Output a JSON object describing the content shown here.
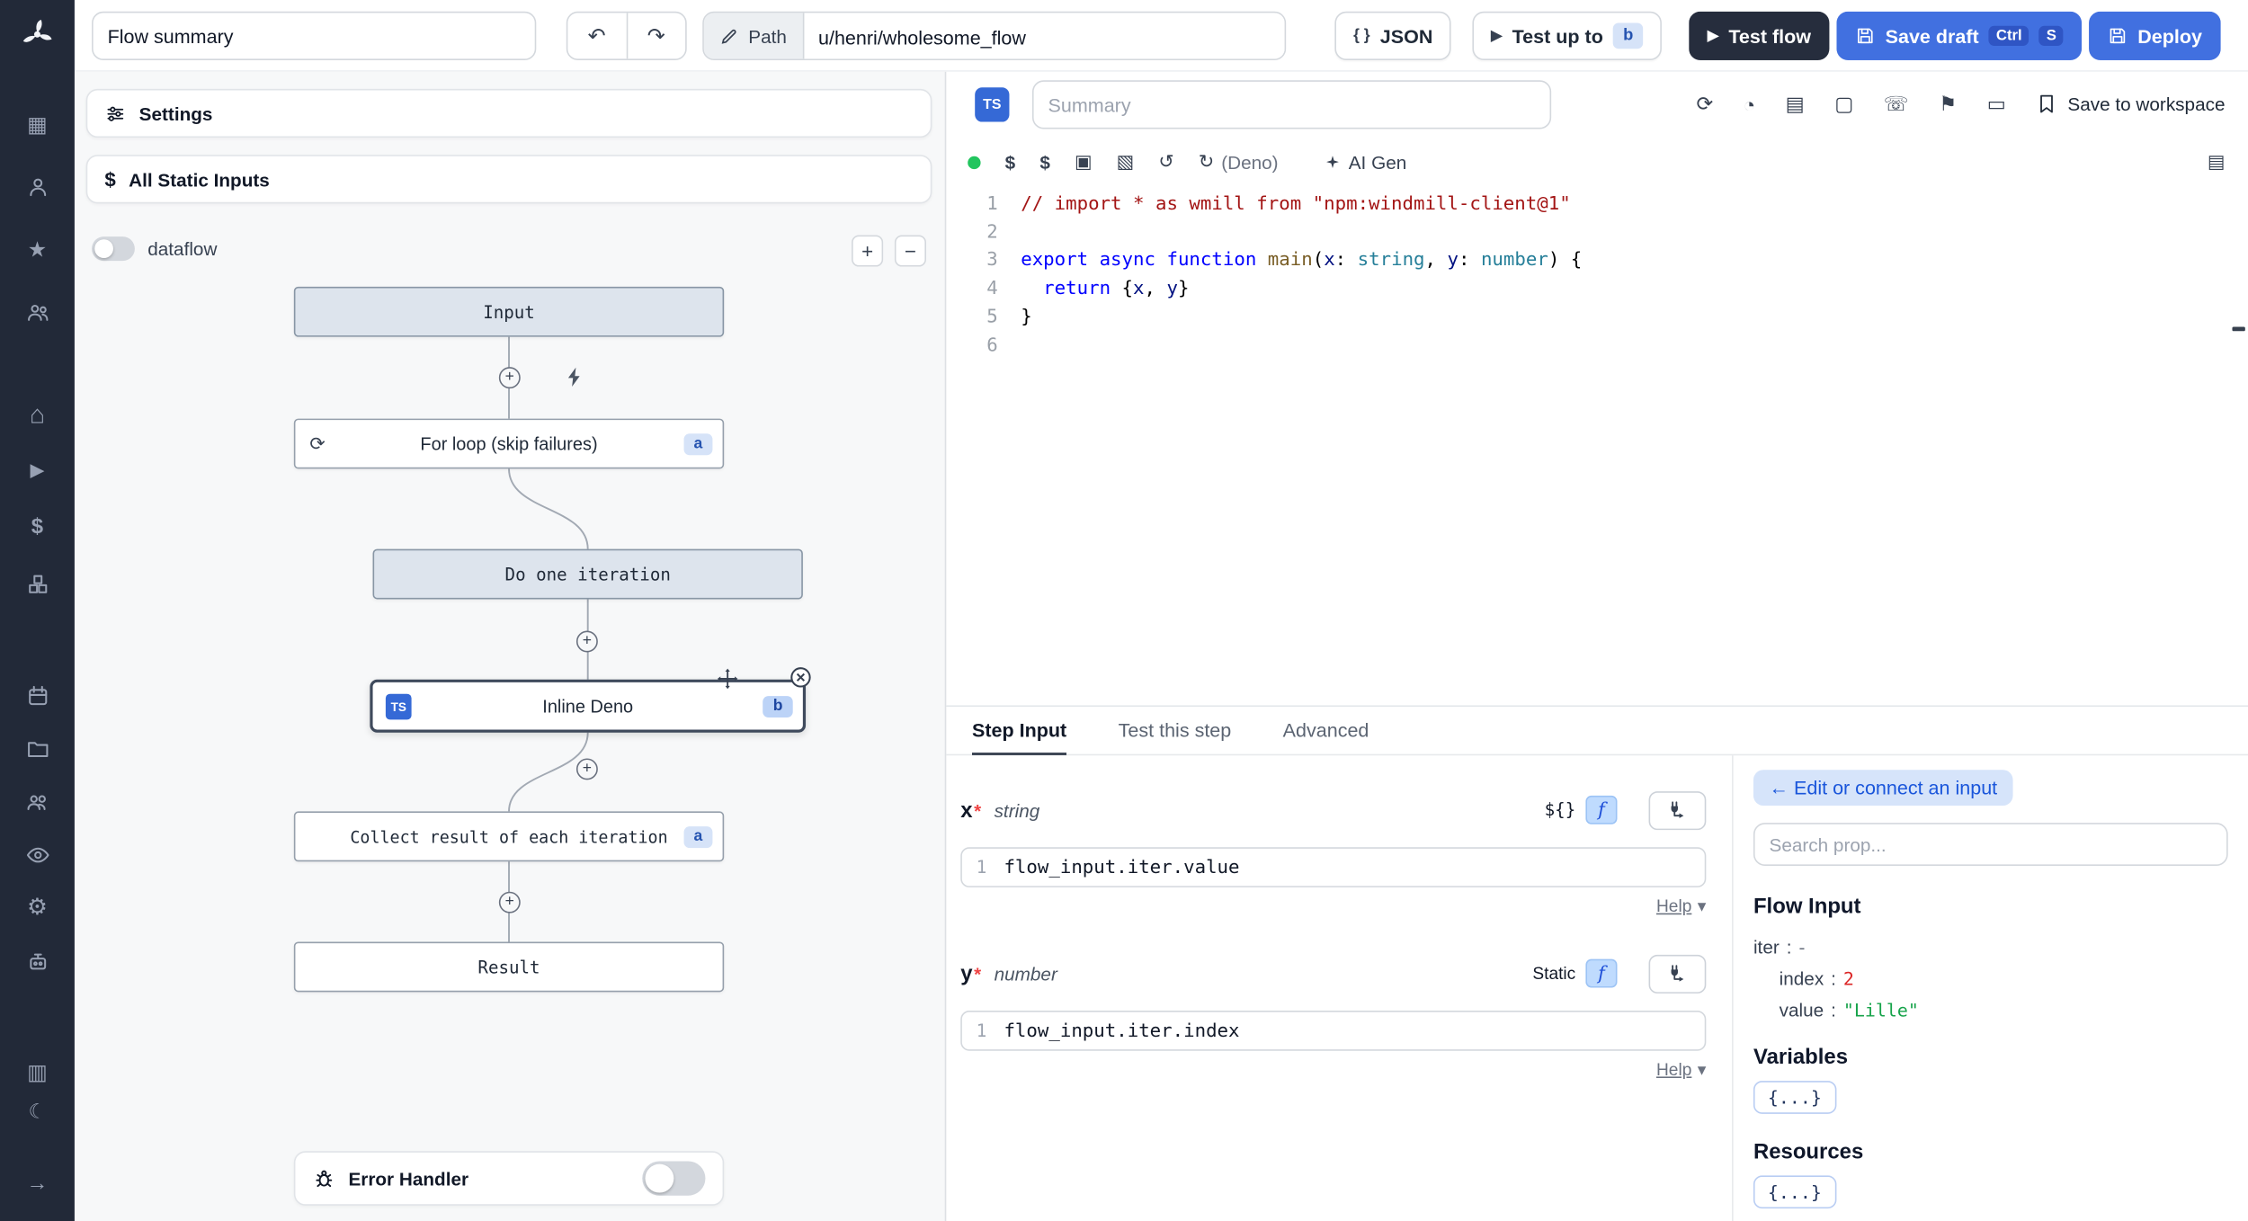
{
  "topbar": {
    "flow_summary": "Flow summary",
    "path_label": "Path",
    "path_value": "u/henri/wholesome_flow",
    "json_label": "JSON",
    "test_up_to_label": "Test up to",
    "test_up_to_badge": "b",
    "test_flow_label": "Test flow",
    "save_draft_label": "Save draft",
    "kbd_ctrl": "Ctrl",
    "kbd_s": "S",
    "deploy_label": "Deploy"
  },
  "flow_panel": {
    "settings_label": "Settings",
    "static_inputs_label": "All Static Inputs",
    "dataflow_label": "dataflow",
    "error_handler_label": "Error Handler",
    "nodes": {
      "input_label": "Input",
      "forloop_label": "For loop (skip failures)",
      "forloop_badge": "a",
      "iteration_label": "Do one iteration",
      "inline_label": "Inline Deno",
      "inline_badge": "b",
      "inline_lang": "TS",
      "collect_label": "Collect result of each iteration",
      "collect_badge": "a",
      "result_label": "Result"
    }
  },
  "editor": {
    "lang_badge": "TS",
    "summary_placeholder": "Summary",
    "save_to_workspace_label": "Save to workspace",
    "deno_label": "(Deno)",
    "ai_gen_label": "AI Gen",
    "lines": [
      {
        "n": 1,
        "tokens": [
          {
            "t": "// import * as wmill from \"npm:windmill-client@1\"",
            "c": "cmt"
          }
        ]
      },
      {
        "n": 2,
        "tokens": []
      },
      {
        "n": 3,
        "tokens": [
          {
            "t": "export",
            "c": "kw"
          },
          {
            "t": " ",
            "c": "pl"
          },
          {
            "t": "async",
            "c": "kw"
          },
          {
            "t": " ",
            "c": "pl"
          },
          {
            "t": "function",
            "c": "kw"
          },
          {
            "t": " ",
            "c": "pl"
          },
          {
            "t": "main",
            "c": "fn"
          },
          {
            "t": "(",
            "c": "pl"
          },
          {
            "t": "x",
            "c": "id"
          },
          {
            "t": ": ",
            "c": "pl"
          },
          {
            "t": "string",
            "c": "ty"
          },
          {
            "t": ", ",
            "c": "pl"
          },
          {
            "t": "y",
            "c": "id"
          },
          {
            "t": ": ",
            "c": "pl"
          },
          {
            "t": "number",
            "c": "ty"
          },
          {
            "t": ") {",
            "c": "pl"
          }
        ]
      },
      {
        "n": 4,
        "tokens": [
          {
            "t": "  ",
            "c": "pl"
          },
          {
            "t": "return",
            "c": "kw"
          },
          {
            "t": " {",
            "c": "pl"
          },
          {
            "t": "x",
            "c": "id"
          },
          {
            "t": ", ",
            "c": "pl"
          },
          {
            "t": "y",
            "c": "id"
          },
          {
            "t": "}",
            "c": "pl"
          }
        ]
      },
      {
        "n": 5,
        "tokens": [
          {
            "t": "}",
            "c": "pl"
          }
        ]
      },
      {
        "n": 6,
        "tokens": []
      }
    ]
  },
  "step_panel": {
    "tabs": {
      "step_input": "Step Input",
      "test_this_step": "Test this step",
      "advanced": "Advanced"
    },
    "fields": {
      "x": {
        "name": "x",
        "required_mark": "*",
        "type": "string",
        "mode": "${}",
        "line_no": "1",
        "expr": "flow_input.iter.value",
        "help_label": "Help"
      },
      "y": {
        "name": "y",
        "required_mark": "*",
        "type": "number",
        "mode": "Static",
        "line_no": "1",
        "expr": "flow_input.iter.index",
        "help_label": "Help"
      }
    }
  },
  "prop_panel": {
    "edit_connect_label": "← Edit or connect an input",
    "search_placeholder": "Search prop...",
    "flow_input_title": "Flow Input",
    "colon_sep": ":",
    "tree": {
      "iter_key": "iter",
      "iter_value": "-",
      "index_key": "index",
      "index_value": "2",
      "value_key": "value",
      "value_value": "\"Lille\""
    },
    "variables_title": "Variables",
    "variables_chip": "{...}",
    "resources_title": "Resources",
    "resources_chip": "{...}"
  },
  "icons": {
    "grid": "▦",
    "star": "★",
    "home": "⌂",
    "play": "▶",
    "dollar": "$",
    "gear": "⚙",
    "moon": "☾",
    "arrow_right": "→",
    "columns": "▥",
    "undo": "↶",
    "redo": "↷",
    "plus": "+",
    "minus": "−",
    "loop": "⟳",
    "retry": "⟳",
    "gauge": "◔",
    "database": "▤",
    "square": "▢",
    "phone": "☏",
    "flag": "⚑",
    "cassette": "▭",
    "package": "▣",
    "package2": "▧",
    "reset": "↺",
    "reload": "↻",
    "book": "▤",
    "braces": "{ }",
    "chevron_down": "▾",
    "f": "f"
  },
  "colors": {
    "accent_blue": "#4170e0",
    "dark_button": "#262d3d",
    "sidebar_bg": "#222938",
    "ts_blue": "#3569d6",
    "green_status": "#22c55e",
    "badge_bg": "#d6e3f8",
    "number_value": "#dc2626",
    "string_value": "#16a34a"
  }
}
